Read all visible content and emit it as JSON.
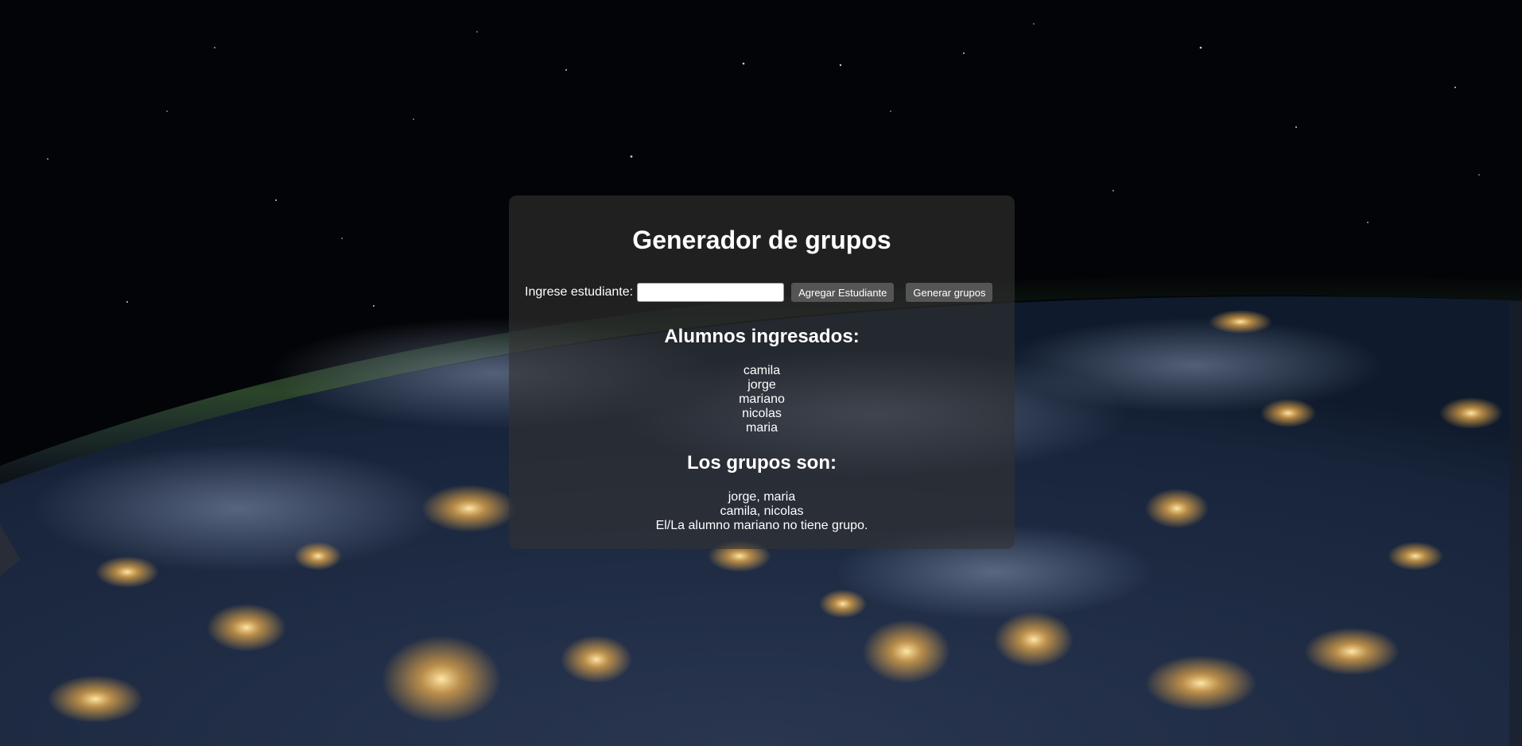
{
  "app": {
    "title": "Generador de grupos"
  },
  "form": {
    "input_label": "Ingrese estudiante:",
    "input_value": "",
    "input_placeholder": "",
    "add_button_label": "Agregar Estudiante",
    "generate_button_label": "Generar grupos"
  },
  "students": {
    "heading": "Alumnos ingresados:",
    "items": [
      "camila",
      "jorge",
      "mariano",
      "nicolas",
      "maria"
    ]
  },
  "groups": {
    "heading": "Los grupos son:",
    "items": [
      "jorge, maria",
      "camila, nicolas",
      "El/La alumno mariano no tiene grupo."
    ]
  },
  "colors": {
    "panel_background": "#323232",
    "button_background": "#555555",
    "text": "#ffffff"
  }
}
